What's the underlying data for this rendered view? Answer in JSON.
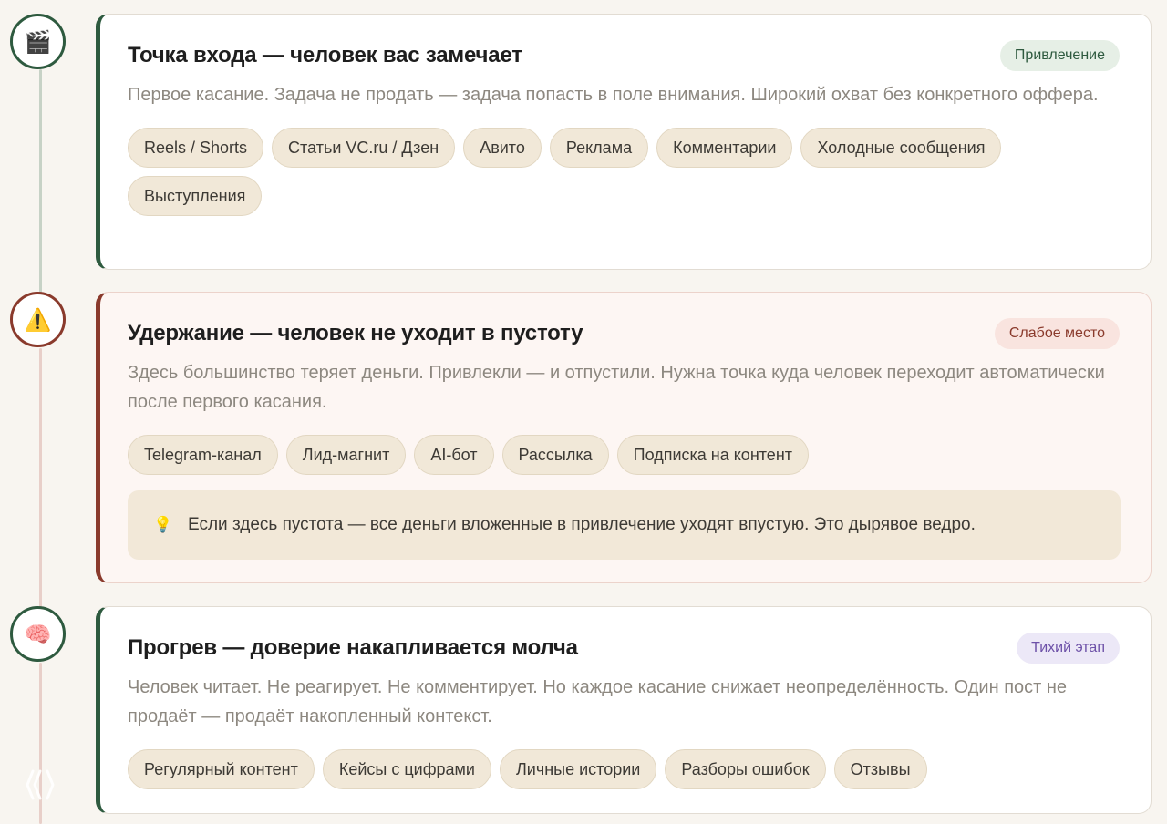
{
  "steps": [
    {
      "icon": "🎬",
      "icon_name": "clapperboard-icon",
      "title": "Точка входа — человек вас замечает",
      "badge": "Привлечение",
      "description": "Первое касание. Задача не продать — задача попасть в поле внимания. Широкий охват без конкретного оффера.",
      "tags": [
        "Reels / Shorts",
        "Статьи VC.ru / Дзен",
        "Авито",
        "Реклама",
        "Комментарии",
        "Холодные сообщения",
        "Выступления"
      ]
    },
    {
      "icon": "⚠️",
      "icon_name": "warning-icon",
      "title": "Удержание — человек не уходит в пустоту",
      "badge": "Слабое место",
      "description": "Здесь большинство теряет деньги. Привлекли — и отпустили. Нужна точка куда человек переходит автоматически после первого касания.",
      "tags": [
        "Telegram-канал",
        "Лид-магнит",
        "AI-бот",
        "Рассылка",
        "Подписка на контент"
      ],
      "note": {
        "icon": "💡",
        "icon_name": "lightbulb-icon",
        "text": "Если здесь пустота — все деньги вложенные в привлечение уходят впустую. Это дырявое ведро."
      }
    },
    {
      "icon": "🧠",
      "icon_name": "brain-icon",
      "title": "Прогрев — доверие накапливается молча",
      "badge": "Тихий этап",
      "description": "Человек читает. Не реагирует. Не комментирует. Но каждое касание снижает неопределённость. Один пост не продаёт — продаёт накопленный контекст.",
      "tags": [
        "Регулярный контент",
        "Кейсы с цифрами",
        "Личные истории",
        "Разборы ошибок",
        "Отзывы"
      ]
    }
  ],
  "colors": {
    "green_accent": "#2e5a3f",
    "red_accent": "#8a3a2c",
    "purple_accent": "#6d51a8",
    "tag_background": "#f1e8d8",
    "page_background": "#f8f5f0"
  }
}
